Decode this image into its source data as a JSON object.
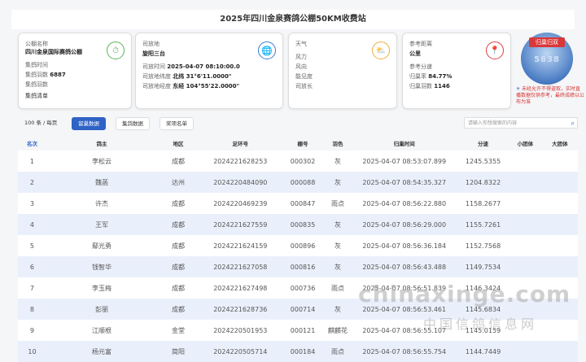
{
  "header": {
    "title": "2025年四川金泉赛鸽公棚50KM收费站"
  },
  "info_card": {
    "l1": "公棚名称",
    "name": "四川金泉国际赛鸽公棚",
    "l2": "集鸽时间",
    "l3_label": "集鸽羽数",
    "count": "6887",
    "l4": "集鸽羽数",
    "l5": "集鸽清单"
  },
  "release_card": {
    "label": "司放地",
    "place": "旋阳三台",
    "time_label": "司放时间",
    "time": "2025-04-07 08:10:00.0",
    "lat_label": "司放地纬度",
    "lat": "北纬 31°6'11.0000\"",
    "lon_label": "司放地经度",
    "lon": "东经 104°55'22.0000\""
  },
  "weather_card": {
    "label": "天气",
    "wind": "风力",
    "dir": "风向",
    "cloud": "能见度",
    "rain": "司放长"
  },
  "distance_card": {
    "label": "参考距离",
    "unit": "公里",
    "speed_label": "参考分速",
    "rate_label": "归巢率",
    "rate": "84.77%",
    "count_label": "归巢羽数",
    "count": "1146"
  },
  "badge": {
    "title": "归巢归双",
    "number": "5838"
  },
  "notice": {
    "text": "未经允许不得盗取，实时直播数据仅供参考，最终成绩以公布为准"
  },
  "toolbar": {
    "per_page": "100 条 / 每页",
    "tabs": [
      "留巢数据",
      "集鸽数据",
      "奖项名单"
    ],
    "search_placeholder": "请输入你想搜索的内容"
  },
  "table": {
    "columns": [
      "名次",
      "鸽主",
      "地区",
      "足环号",
      "棚号",
      "羽色",
      "归巢时间",
      "分速",
      "小团体",
      "大团体"
    ],
    "rows": [
      [
        "1",
        "李松云",
        "成都",
        "2024221628253",
        "000302",
        "灰",
        "2025-04-07 08:53:07.899",
        "1245.5355",
        "",
        ""
      ],
      [
        "2",
        "魏菡",
        "达州",
        "2024220484090",
        "000088",
        "灰",
        "2025-04-07 08:54:35.327",
        "1204.8322",
        "",
        ""
      ],
      [
        "3",
        "许杰",
        "成都",
        "2024220469239",
        "000847",
        "雨点",
        "2025-04-07 08:56:22.880",
        "1158.2677",
        "",
        ""
      ],
      [
        "4",
        "王军",
        "成都",
        "2024221627559",
        "000835",
        "灰",
        "2025-04-07 08:56:29.000",
        "1155.7261",
        "",
        ""
      ],
      [
        "5",
        "鄢光勇",
        "成都",
        "2024221624159",
        "000896",
        "灰",
        "2025-04-07 08:56:36.184",
        "1152.7568",
        "",
        ""
      ],
      [
        "6",
        "钱智华",
        "成都",
        "2024221627058",
        "000816",
        "灰",
        "2025-04-07 08:56:43.488",
        "1149.7534",
        "",
        ""
      ],
      [
        "7",
        "李玉梅",
        "成都",
        "2024221627498",
        "000736",
        "雨点",
        "2025-04-07 08:56:51.839",
        "1146.3424",
        "",
        ""
      ],
      [
        "8",
        "彭丽",
        "成都",
        "2024221628736",
        "000714",
        "灰",
        "2025-04-07 08:56:53.461",
        "1145.6834",
        "",
        ""
      ],
      [
        "9",
        "江顺根",
        "金堂",
        "2024220501953",
        "000121",
        "麒麟花",
        "2025-04-07 08:56:55.107",
        "1145.0159",
        "",
        ""
      ],
      [
        "10",
        "杨元富",
        "简阳",
        "2024220505714",
        "000184",
        "雨点",
        "2025-04-07 08:56:55.754",
        "1144.7449",
        "",
        ""
      ]
    ]
  },
  "watermark": {
    "text": "chinaxinge.com",
    "text2": "中国信鸽信息网"
  },
  "colors": {
    "accent": "#2f63c5",
    "alert": "#d93030"
  }
}
